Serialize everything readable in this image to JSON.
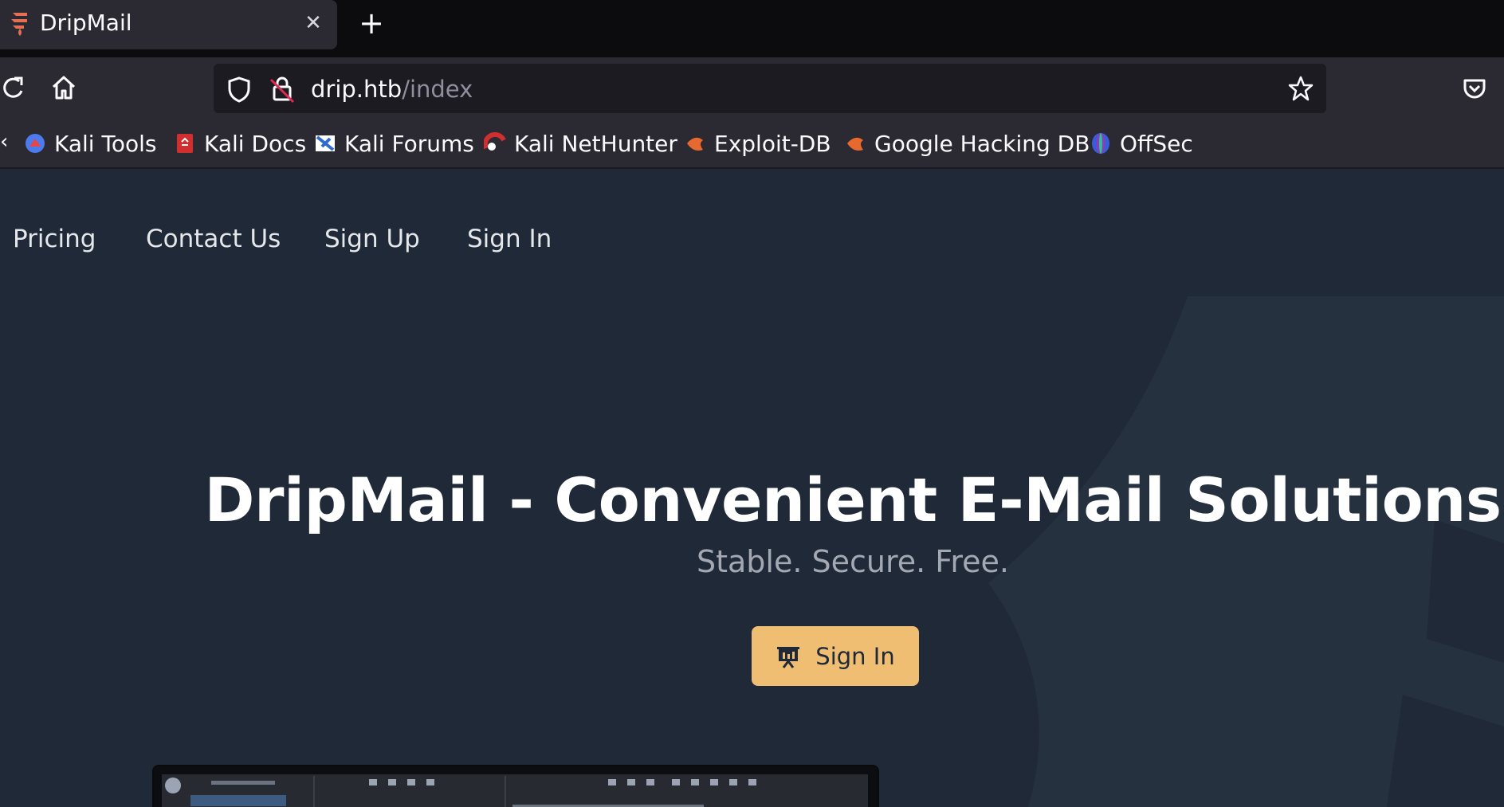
{
  "browser": {
    "tab": {
      "title": "DripMail",
      "close_glyph": "✕"
    },
    "new_tab_glyph": "+",
    "url": {
      "host": "drip.htb",
      "path": "/index"
    },
    "icons": {
      "reload": "reload-icon",
      "home": "home-icon",
      "shield": "tracking-protection-shield-icon",
      "lock": "insecure-lock-icon",
      "star": "bookmark-star-icon",
      "pocket": "pocket-icon"
    },
    "bookmarks": [
      {
        "label": "Kali Tools",
        "icon": "kali-tools-icon"
      },
      {
        "label": "Kali Docs",
        "icon": "kali-docs-icon"
      },
      {
        "label": "Kali Forums",
        "icon": "kali-forums-icon"
      },
      {
        "label": "Kali NetHunter",
        "icon": "kali-nethunter-icon"
      },
      {
        "label": "Exploit-DB",
        "icon": "exploit-db-icon"
      },
      {
        "label": "Google Hacking DB",
        "icon": "google-hacking-db-icon"
      },
      {
        "label": "OffSec",
        "icon": "offsec-icon"
      }
    ]
  },
  "site": {
    "nav": [
      "Pricing",
      "Contact Us",
      "Sign Up",
      "Sign In"
    ],
    "hero": {
      "title": "DripMail - Convenient E-Mail Solutions",
      "subtitle": "Stable. Secure. Free.",
      "cta_label": "Sign In",
      "cta_icon": "presentation-board-icon"
    }
  },
  "colors": {
    "page_bg": "#1f2937",
    "cta_bg": "#f0be72",
    "chrome_bg": "#2b2a33"
  }
}
